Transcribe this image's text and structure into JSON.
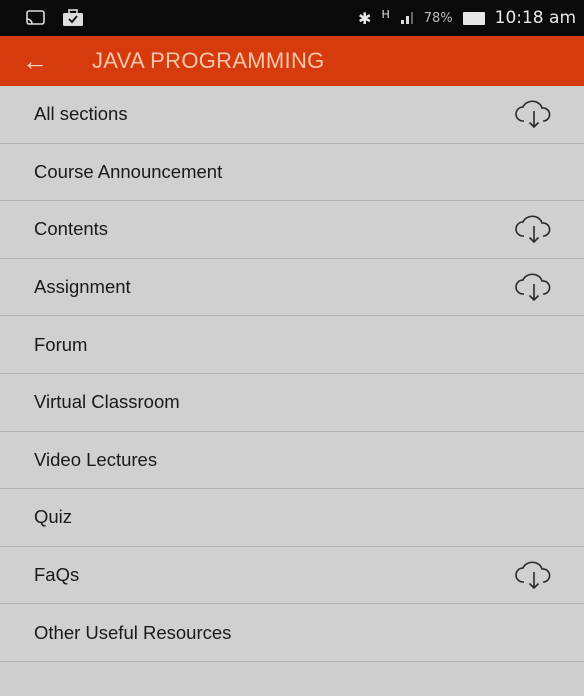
{
  "status_bar": {
    "left_icons": [
      "screen-cast-icon",
      "briefcase-icon"
    ],
    "right_icons": [
      "bluetooth-icon",
      "signal-icon"
    ],
    "network": "H",
    "battery_pct": "78%",
    "time": "10:18 am"
  },
  "app_bar": {
    "back_icon": "arrow-left-icon",
    "title": "JAVA PROGRAMMING",
    "color": "#d53b0c"
  },
  "items": [
    {
      "label": "All sections",
      "download": true
    },
    {
      "label": "Course Announcement",
      "download": false
    },
    {
      "label": "Contents",
      "download": true
    },
    {
      "label": "Assignment",
      "download": true
    },
    {
      "label": "Forum",
      "download": false
    },
    {
      "label": "Virtual Classroom",
      "download": false
    },
    {
      "label": "Video Lectures",
      "download": false
    },
    {
      "label": "Quiz",
      "download": false
    },
    {
      "label": "FaQs",
      "download": true
    },
    {
      "label": "Other Useful Resources",
      "download": false
    }
  ]
}
